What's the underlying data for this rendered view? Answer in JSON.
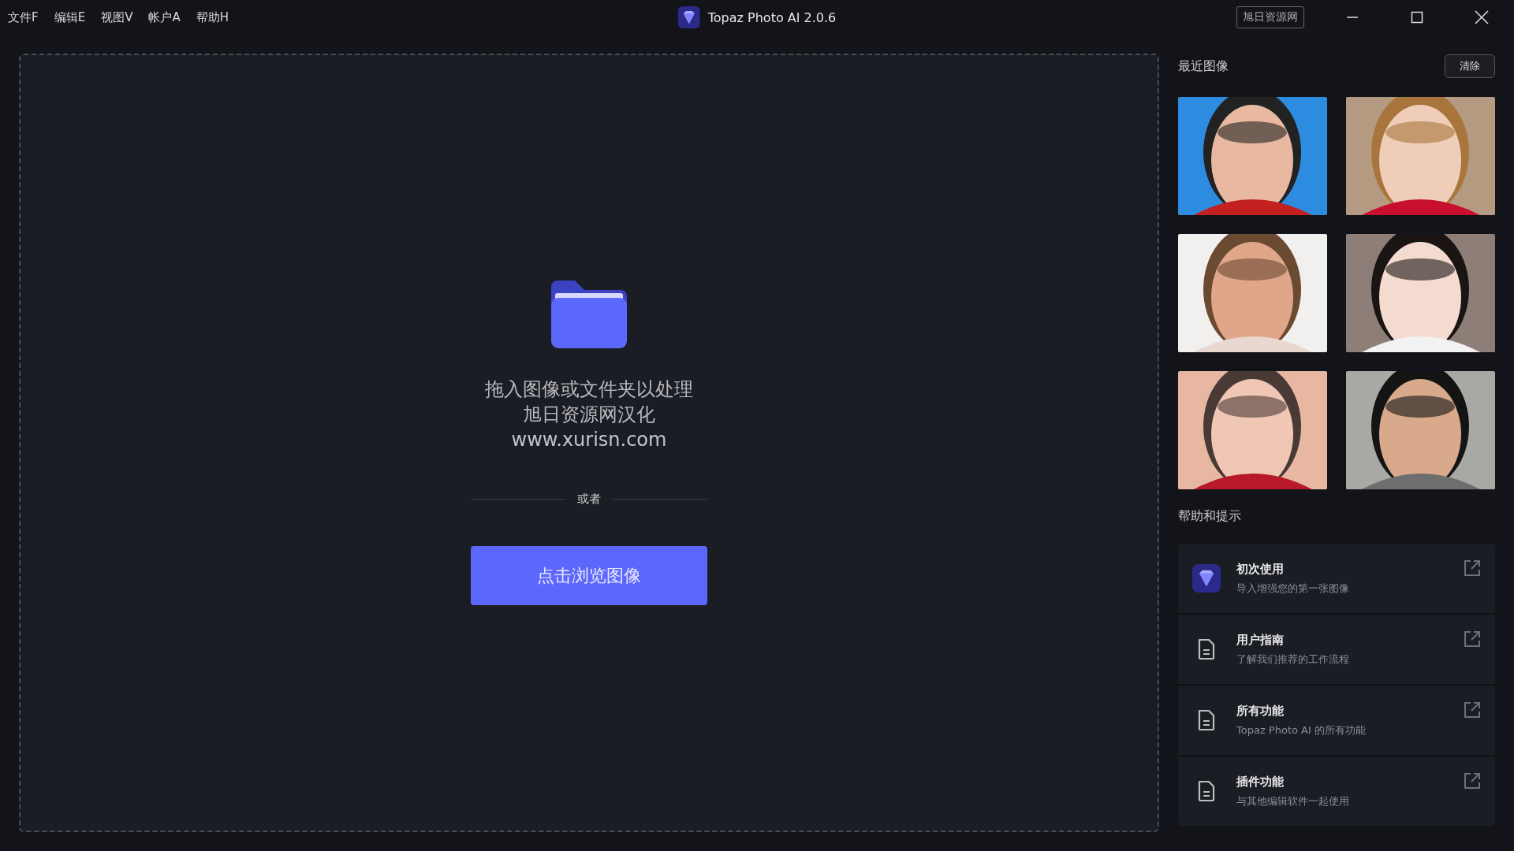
{
  "menu": [
    "文件F",
    "编辑E",
    "视图V",
    "帐户A",
    "帮助H"
  ],
  "window": {
    "title": "Topaz Photo AI 2.0.6",
    "badge": "旭日资源网"
  },
  "dropzone": {
    "lines": [
      "拖入图像或文件夹以处理",
      "旭日资源网汉化",
      "www.xurisn.com"
    ],
    "separator": "或者",
    "button": "点击浏览图像"
  },
  "recent": {
    "title": "最近图像",
    "clear": "清除"
  },
  "help": {
    "title": "帮助和提示",
    "items": [
      {
        "kind": "app",
        "title": "初次使用",
        "subtitle": "导入增强您的第一张图像"
      },
      {
        "kind": "doc",
        "title": "用户指南",
        "subtitle": "了解我们推荐的工作流程"
      },
      {
        "kind": "doc",
        "title": "所有功能",
        "subtitle": "Topaz Photo AI 的所有功能"
      },
      {
        "kind": "doc",
        "title": "插件功能",
        "subtitle": "与其他编辑软件一起使用"
      }
    ]
  }
}
